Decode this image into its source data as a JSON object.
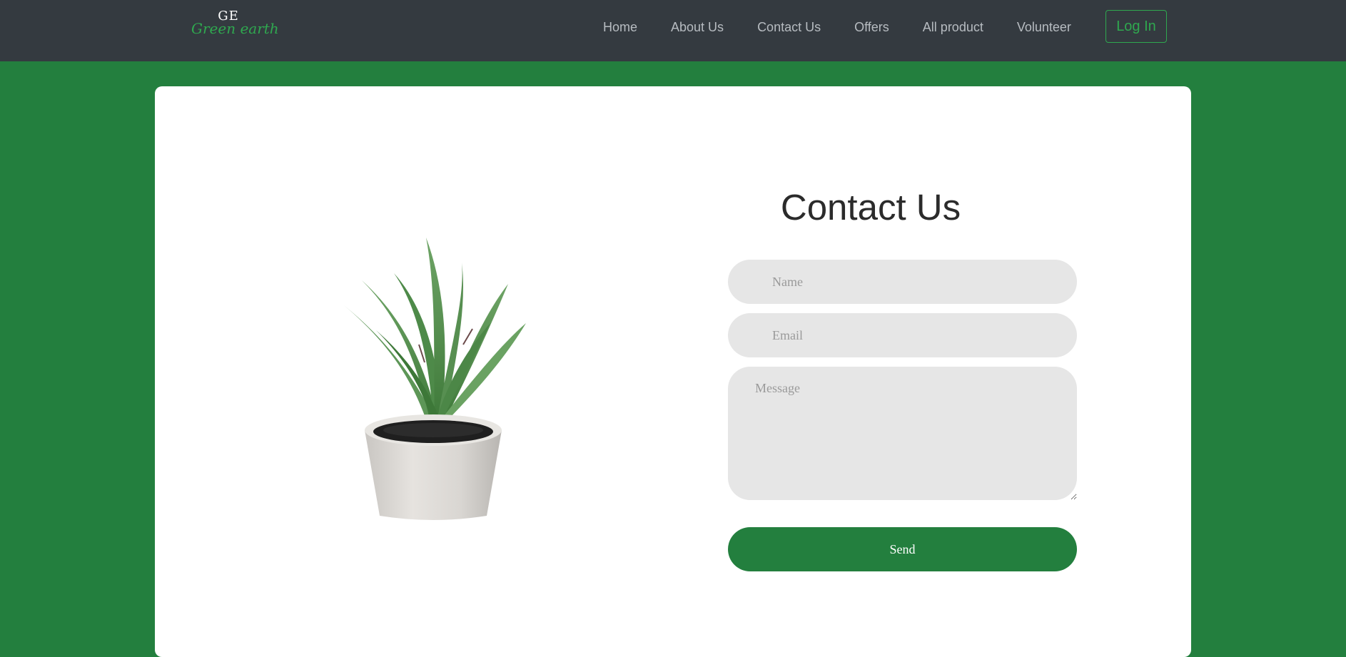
{
  "brand": {
    "initials": "GE",
    "name": "Green earth"
  },
  "nav": {
    "links": [
      "Home",
      "About Us",
      "Contact Us",
      "Offers",
      "All product",
      "Volunteer"
    ],
    "login_label": "Log In"
  },
  "contact": {
    "title": "Contact Us",
    "name_placeholder": "Name",
    "email_placeholder": "Email",
    "message_placeholder": "Message",
    "send_label": "Send"
  },
  "colors": {
    "navbar_bg": "#343a40",
    "page_bg": "#237f3e",
    "accent": "#2fa84f",
    "input_bg": "#e6e6e6",
    "button_bg": "#237f3e"
  },
  "images": {
    "hero": "potted-aloe-plant"
  }
}
